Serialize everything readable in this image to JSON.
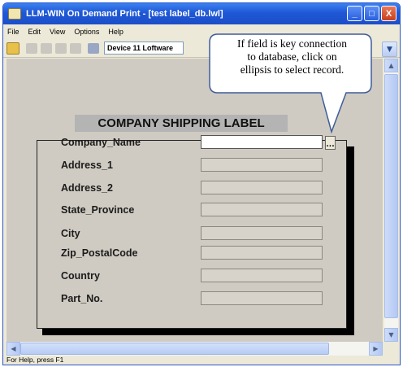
{
  "window": {
    "title": "LLM-WIN On Demand Print - [test label_db.lwl]",
    "controls": {
      "minimize": "_",
      "maximize": "□",
      "close": "X"
    }
  },
  "menu": [
    "File",
    "Edit",
    "View",
    "Options",
    "Help"
  ],
  "toolbar": {
    "device": "Device 11 Loftware",
    "icons": [
      "open-folder-icon",
      "print-icon",
      "print-icon",
      "print-icon",
      "print-icon",
      "printer-icon"
    ]
  },
  "label": {
    "title": "COMPANY SHIPPING LABEL",
    "fields": [
      {
        "name": "Company_Name",
        "value": ""
      },
      {
        "name": "Address_1",
        "value": ""
      },
      {
        "name": "Address_2",
        "value": ""
      },
      {
        "name": "State_Province",
        "value": ""
      },
      {
        "name": "City",
        "value": ""
      },
      {
        "name": "Zip_PostalCode",
        "value": ""
      },
      {
        "name": "Country",
        "value": ""
      },
      {
        "name": "Part_No.",
        "value": ""
      }
    ],
    "ellipsis_label": "..."
  },
  "callout": {
    "lines": [
      "If field is key connection",
      "to database, click on",
      "ellipsis to select record."
    ]
  },
  "status": "For Help, press F1",
  "colors": {
    "titlebar": "#1f57d6",
    "window_bg": "#ece9d8",
    "label_bg": "#cfcbc2"
  }
}
